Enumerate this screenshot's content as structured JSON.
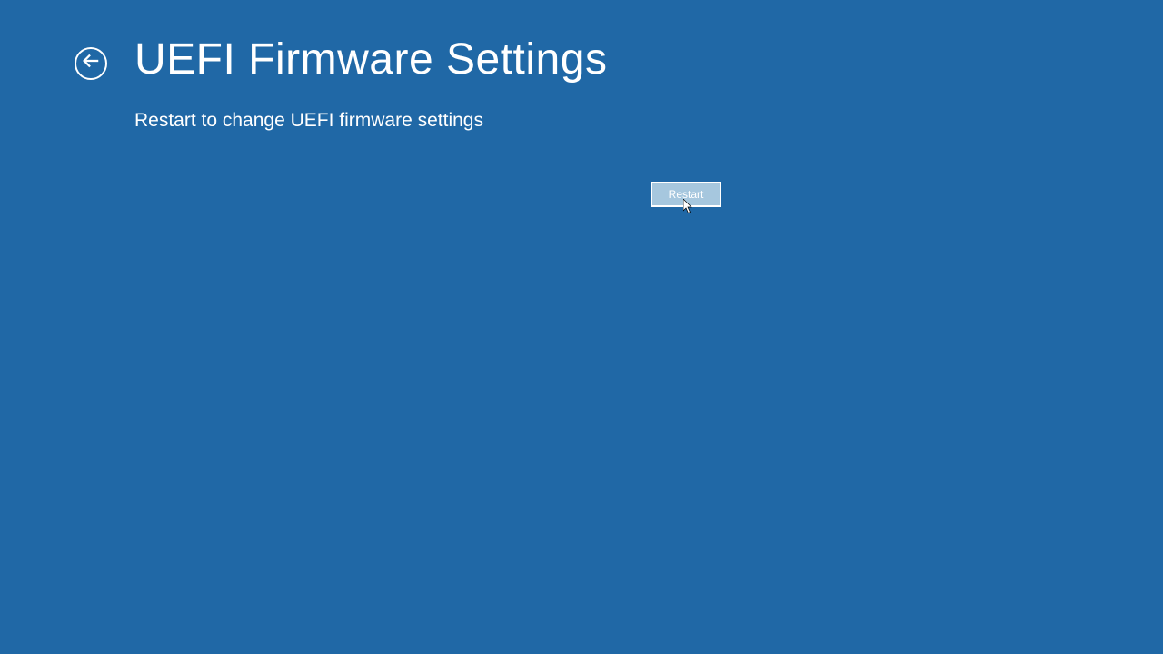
{
  "header": {
    "title": "UEFI Firmware Settings"
  },
  "content": {
    "description": "Restart to change UEFI firmware settings"
  },
  "actions": {
    "restart_label": "Restart"
  }
}
